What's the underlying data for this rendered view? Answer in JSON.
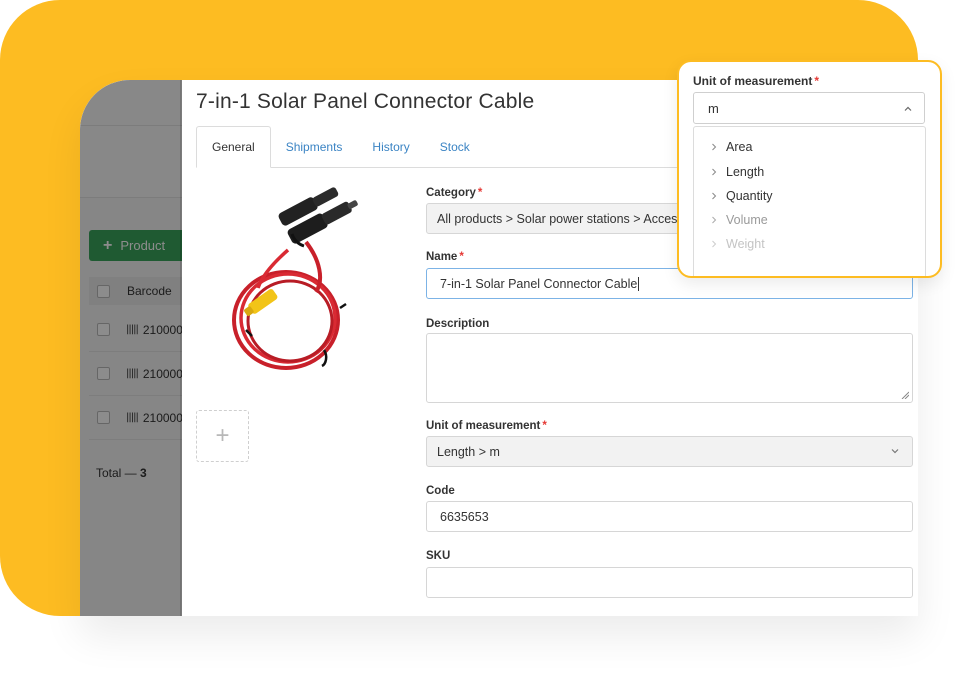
{
  "background_list": {
    "add_button_label": "Product",
    "column_barcode": "Barcode",
    "rows": [
      {
        "barcode": "210000"
      },
      {
        "barcode": "210000"
      },
      {
        "barcode": "210000"
      }
    ],
    "total_prefix": "Total — ",
    "total_count": "3"
  },
  "product": {
    "title": "7-in-1 Solar Panel Connector Cable",
    "tabs": [
      {
        "label": "General",
        "active": true
      },
      {
        "label": "Shipments",
        "active": false
      },
      {
        "label": "History",
        "active": false
      },
      {
        "label": "Stock",
        "active": false
      }
    ],
    "add_photo_label": "+"
  },
  "form": {
    "category": {
      "label": "Category",
      "value": "All products > Solar power stations > Accessories"
    },
    "name": {
      "label": "Name",
      "value": "7-in-1 Solar Panel Connector Cable"
    },
    "description": {
      "label": "Description",
      "value": ""
    },
    "unit": {
      "label": "Unit of measurement",
      "value": "Length > m"
    },
    "code": {
      "label": "Code",
      "value": "6635653"
    },
    "sku": {
      "label": "SKU",
      "value": ""
    }
  },
  "unit_dropdown": {
    "label": "Unit of measurement",
    "search_value": "m",
    "options": [
      "Area",
      "Length",
      "Quantity",
      "Volume",
      "Weight"
    ]
  },
  "colors": {
    "accent_yellow": "#FDBC22",
    "link_blue": "#3b84c4",
    "add_button_green": "#3aa55c",
    "required_red": "#e53935"
  }
}
